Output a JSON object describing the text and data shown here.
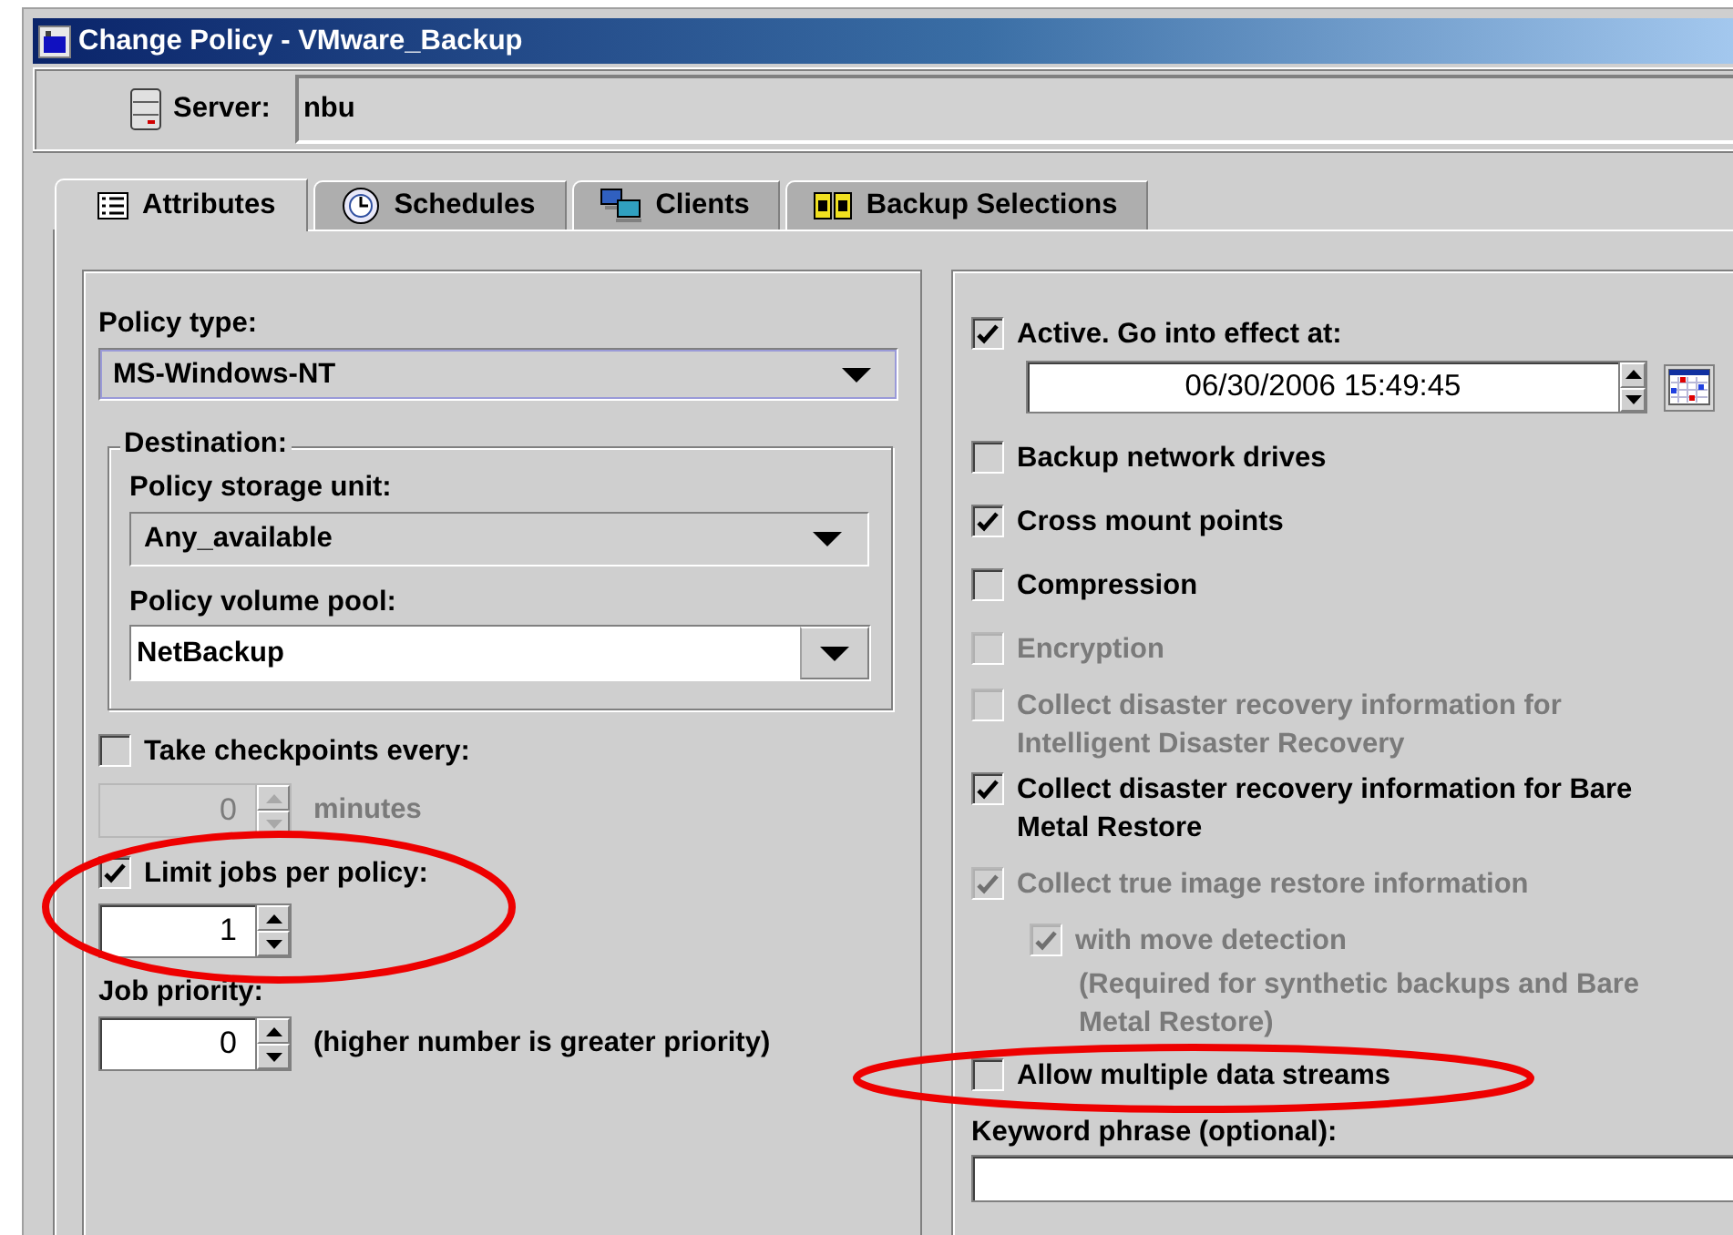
{
  "window": {
    "title": "Change Policy - VMware_Backup"
  },
  "server": {
    "label": "Server:",
    "value": "nbu"
  },
  "tabs": [
    {
      "label": "Attributes",
      "kind": "list",
      "selected": true
    },
    {
      "label": "Schedules",
      "kind": "clock",
      "selected": false
    },
    {
      "label": "Clients",
      "kind": "computers",
      "selected": false
    },
    {
      "label": "Backup Selections",
      "kind": "books",
      "selected": false
    }
  ],
  "left": {
    "policy_type": {
      "label": "Policy type:",
      "value": "MS-Windows-NT",
      "kind": "list"
    },
    "destination": {
      "title": "Destination:",
      "storage_unit": {
        "label": "Policy storage unit:",
        "value": "Any_available",
        "kind": "list"
      },
      "volume_pool": {
        "label": "Policy volume pool:",
        "value": "NetBackup",
        "kind": "editable"
      }
    },
    "checkpoints": {
      "label": "Take checkpoints every:",
      "checked": false,
      "value": "0",
      "unit": "minutes",
      "disabled": true
    },
    "limit_jobs": {
      "label": "Limit jobs per policy:",
      "checked": true,
      "value": "1",
      "disabled": false
    },
    "job_priority": {
      "label": "Job priority:",
      "value": "0",
      "hint": "(higher number is greater priority)"
    }
  },
  "options": [
    {
      "kind": "check",
      "label_lines": [
        "Active. Go into effect at:"
      ],
      "checked": true,
      "disabled": false,
      "date": "06/30/2006 15:49:45"
    },
    {
      "kind": "check",
      "label_lines": [
        "Backup network drives"
      ],
      "checked": false,
      "disabled": false
    },
    {
      "kind": "check",
      "label_lines": [
        "Cross mount points"
      ],
      "checked": true,
      "disabled": false
    },
    {
      "kind": "check",
      "label_lines": [
        "Compression"
      ],
      "checked": false,
      "disabled": false
    },
    {
      "kind": "check",
      "label_lines": [
        "Encryption"
      ],
      "checked": false,
      "disabled": true
    },
    {
      "kind": "check",
      "label_lines": [
        "Collect disaster recovery information for",
        "Intelligent Disaster Recovery"
      ],
      "checked": false,
      "disabled": true
    },
    {
      "kind": "check",
      "label_lines": [
        "Collect disaster recovery information for Bare",
        "Metal Restore"
      ],
      "checked": true,
      "disabled": false
    },
    {
      "kind": "check",
      "label_lines": [
        "Collect true image restore information"
      ],
      "checked": true,
      "disabled": true,
      "children": [
        {
          "kind": "check",
          "label_lines": [
            "with move detection"
          ],
          "checked": true,
          "disabled": true,
          "note_lines": [
            "(Required for synthetic backups and Bare",
            "Metal Restore)"
          ]
        }
      ]
    },
    {
      "kind": "check",
      "label_lines": [
        "Allow multiple data streams"
      ],
      "checked": false,
      "disabled": false
    },
    {
      "kind": "field",
      "label_lines": [
        "Keyword phrase (optional):"
      ]
    }
  ],
  "annotations": [
    {
      "kind": "ellipse"
    },
    {
      "kind": "ellipse"
    }
  ]
}
